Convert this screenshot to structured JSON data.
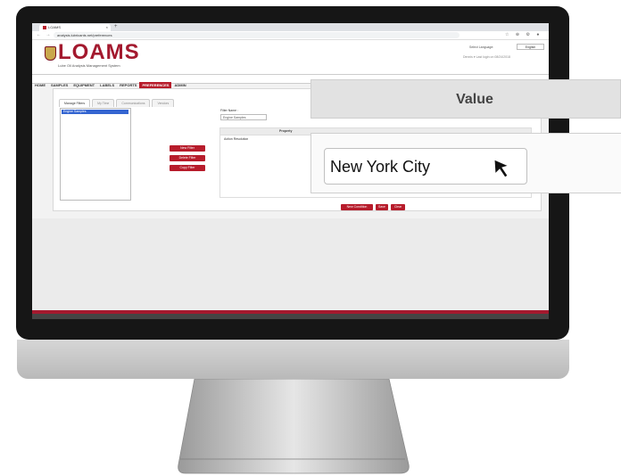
{
  "browser": {
    "tab_title": "LOAMS",
    "tab_close": "×",
    "new_tab": "+",
    "nav_icons": "← → C",
    "url": "analysis.lubricants.net/preferences",
    "toolbar_icons": "☆ ⊕ ⚙ ●"
  },
  "app": {
    "logo_text": "LOAMS",
    "logo_subtitle": "Lube Oil Analysis Management System",
    "language_label": "Select Language:",
    "language_value": "English",
    "user_info": "Dennis  ▾    Last login on 08/24/2018"
  },
  "menu": {
    "items": [
      "HOME",
      "SAMPLES",
      "EQUIPMENT",
      "LABELS",
      "REPORTS",
      "PREFERENCES",
      "ADMIN"
    ],
    "active_index": 5
  },
  "tabs": [
    "Manage Filters",
    "My Time",
    "Communications",
    "Vendors"
  ],
  "filters": {
    "selected_item": "Engine Samples",
    "new_button": "New Filter",
    "delete_button": "Delete Filter",
    "copy_button": "Copy Filter",
    "name_label": "Filter Name :",
    "name_value": "Engine Samples",
    "table_header": "Property",
    "table_row": "Action Resolution",
    "new_condition_button": "New Condition",
    "save_button": "Save",
    "clear_button": "Clear"
  },
  "zoom": {
    "header": "Value",
    "input_value": "New York City"
  },
  "colors": {
    "brand_red": "#a3192e",
    "button_red": "#b71c2b",
    "selection_blue": "#3465d1"
  }
}
